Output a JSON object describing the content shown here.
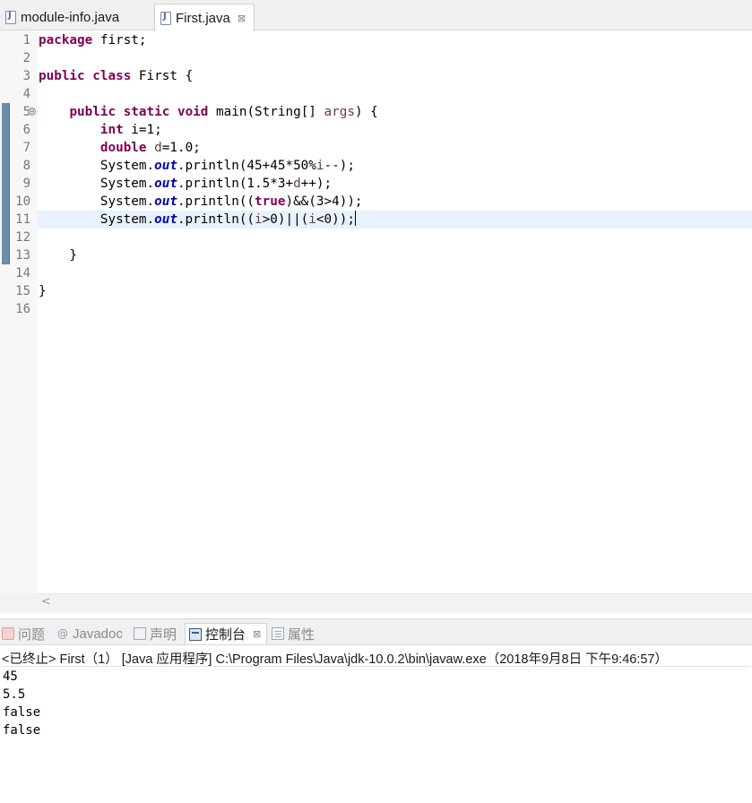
{
  "editor_tabs": [
    {
      "label": "module-info.java",
      "active": false
    },
    {
      "label": "First.java",
      "active": true,
      "close": "⊠"
    }
  ],
  "editor": {
    "line_numbers": [
      "1",
      "2",
      "3",
      "4",
      "5",
      "6",
      "7",
      "8",
      "9",
      "10",
      "11",
      "12",
      "13",
      "14",
      "15",
      "16"
    ],
    "tokens": {
      "l1_kw": "package",
      "l1_rest": " first;",
      "l3_kw1": "public",
      "l3_kw2": "class",
      "l3_rest": " First {",
      "l5_indent": "    ",
      "l5_kw1": "public",
      "l5_kw2": "static",
      "l5_kw3": "void",
      "l5_mid": " main(String[] ",
      "l5_arg": "args",
      "l5_end": ") {",
      "l6_indent": "        ",
      "l6_kw": "int",
      "l6_rest": " i=1;",
      "l7_indent": "        ",
      "l7_kw": "double",
      "l7_sp": " ",
      "l7_var": "d",
      "l7_rest": "=1.0;",
      "l8_pre": "        System.",
      "l8_out": "out",
      "l8_mid": ".println(45+45*50%",
      "l8_var": "i",
      "l8_end": "--);",
      "l9_pre": "        System.",
      "l9_out": "out",
      "l9_mid": ".println(1.5*3+",
      "l9_var": "d",
      "l9_end": "++);",
      "l10_pre": "        System.",
      "l10_out": "out",
      "l10_mid": ".println((",
      "l10_kw": "true",
      "l10_end": ")&&(3>4));",
      "l11_pre": "        System.",
      "l11_out": "out",
      "l11_mid": ".println((",
      "l11_v1": "i",
      "l11_m2": ">0)||(",
      "l11_v2": "i",
      "l11_end": "<0));",
      "l13": "    }",
      "l15": "}"
    },
    "fold_icon": "⊖",
    "scroll_left": "<"
  },
  "view_tabs": [
    {
      "label": "问题",
      "icon": "problems-icon"
    },
    {
      "label": "Javadoc",
      "icon": "at-icon",
      "glyph": "@"
    },
    {
      "label": "声明",
      "icon": "declaration-icon"
    },
    {
      "label": "控制台",
      "icon": "console-icon",
      "active": true,
      "close": "⊠"
    },
    {
      "label": "属性",
      "icon": "properties-icon"
    }
  ],
  "console": {
    "header": "<已终止> First（1） [Java 应用程序] C:\\Program Files\\Java\\jdk-10.0.2\\bin\\javaw.exe（2018年9月8日 下午9:46:57）",
    "output": [
      "45",
      "5.5",
      "false",
      "false"
    ]
  },
  "colors": {
    "keyword": "#7f0055",
    "static_field": "#0000c0",
    "local_var": "#6a3e3e",
    "current_line": "#e8f2fe"
  }
}
